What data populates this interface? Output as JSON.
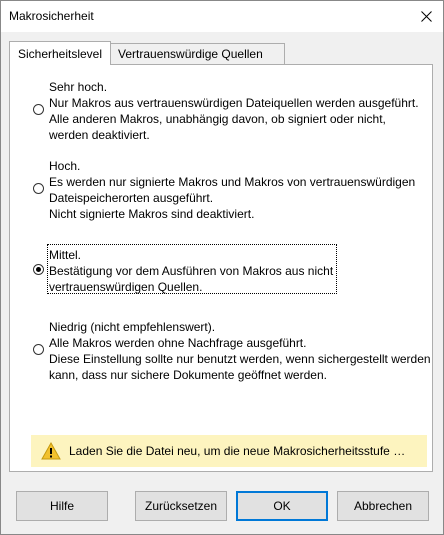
{
  "window": {
    "title": "Makrosicherheit"
  },
  "tabs": [
    {
      "label": "Sicherheitslevel",
      "active": true
    },
    {
      "label": "Vertrauenswürdige Quellen",
      "active": false
    }
  ],
  "options": [
    {
      "lines": [
        "Sehr hoch.",
        "Nur Makros aus vertrauenswürdigen Dateiquellen werden ausgeführt.",
        "Alle anderen Makros, unabhängig davon, ob signiert oder nicht,",
        "werden deaktiviert."
      ],
      "selected": false
    },
    {
      "lines": [
        "Hoch.",
        "Es werden nur signierte Makros und Makros von vertrauenswürdigen",
        "Dateispeicherorten ausgeführt.",
        "Nicht signierte Makros sind deaktiviert."
      ],
      "selected": false
    },
    {
      "lines": [
        "Mittel.",
        "Bestätigung vor dem Ausführen von Makros aus nicht",
        "vertrauenswürdigen Quellen."
      ],
      "selected": true
    },
    {
      "lines": [
        "Niedrig (nicht empfehlenswert).",
        "Alle Makros werden ohne Nachfrage ausgeführt.",
        "Diese Einstellung sollte nur benutzt werden, wenn sichergestellt werden",
        "kann, dass nur sichere Dokumente geöffnet werden."
      ],
      "selected": false
    }
  ],
  "warning": {
    "icon": "warning-triangle-icon",
    "text": "Laden Sie die Datei neu, um die neue Makrosicherheitsstufe an...",
    "background": "#fdf4bf"
  },
  "buttons": {
    "help": "Hilfe",
    "reset": "Zurücksetzen",
    "ok": "OK",
    "cancel": "Abbrechen"
  },
  "colors": {
    "accent": "#0078d7",
    "warning_icon": "#f2c12e"
  }
}
